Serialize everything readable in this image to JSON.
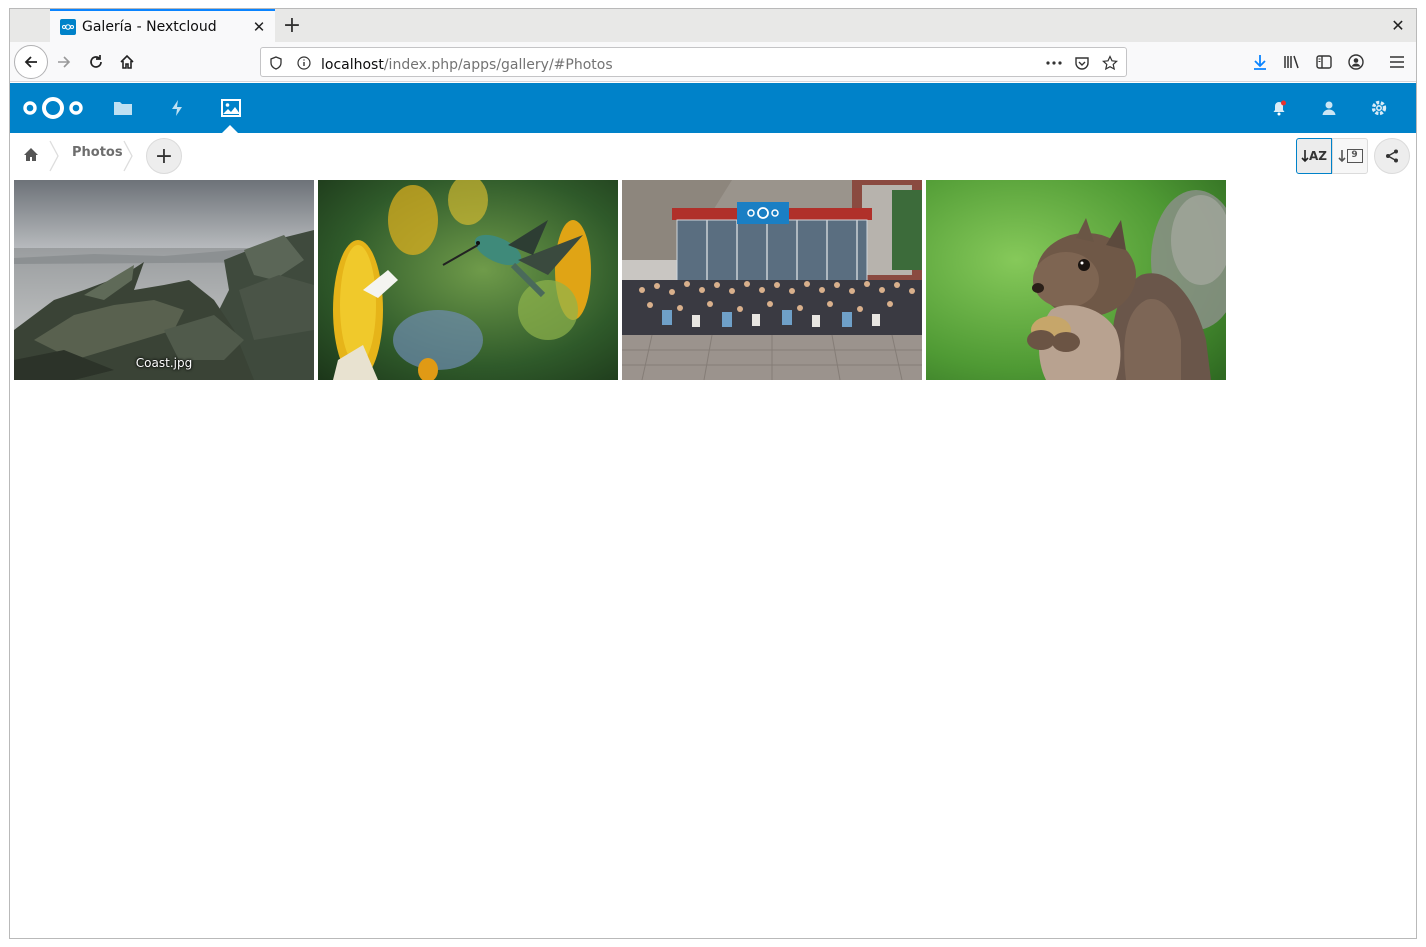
{
  "browser": {
    "tab_title": "Galería - Nextcloud",
    "url_host": "localhost",
    "url_path": "/index.php/apps/gallery/#Photos"
  },
  "nextcloud": {
    "apps": [
      "files-icon",
      "activity-icon",
      "gallery-icon"
    ],
    "active_app": "gallery",
    "brand_color": "#0082c9"
  },
  "breadcrumb": {
    "current": "Photos"
  },
  "sort": {
    "by_name_label": "AZ",
    "by_date_label": "9"
  },
  "gallery": {
    "items": [
      {
        "caption": "Coast.jpg"
      },
      {
        "caption": ""
      },
      {
        "caption": ""
      },
      {
        "caption": ""
      }
    ]
  }
}
